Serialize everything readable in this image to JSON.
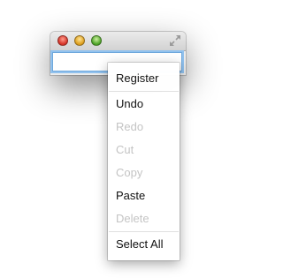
{
  "window": {
    "traffic_lights": {
      "close_color": "#d8362a",
      "minimize_color": "#dfa01f",
      "zoom_color": "#4fa528"
    },
    "resize_icon": "fullscreen-arrows-icon"
  },
  "text_field": {
    "value": "",
    "focus_color": "#6fa8dc"
  },
  "context_menu": {
    "items": [
      {
        "label": "Register",
        "enabled": true
      },
      {
        "label": "Undo",
        "enabled": true
      },
      {
        "label": "Redo",
        "enabled": false
      },
      {
        "label": "Cut",
        "enabled": false
      },
      {
        "label": "Copy",
        "enabled": false
      },
      {
        "label": "Paste",
        "enabled": true
      },
      {
        "label": "Delete",
        "enabled": false
      },
      {
        "label": "Select All",
        "enabled": true
      }
    ]
  }
}
